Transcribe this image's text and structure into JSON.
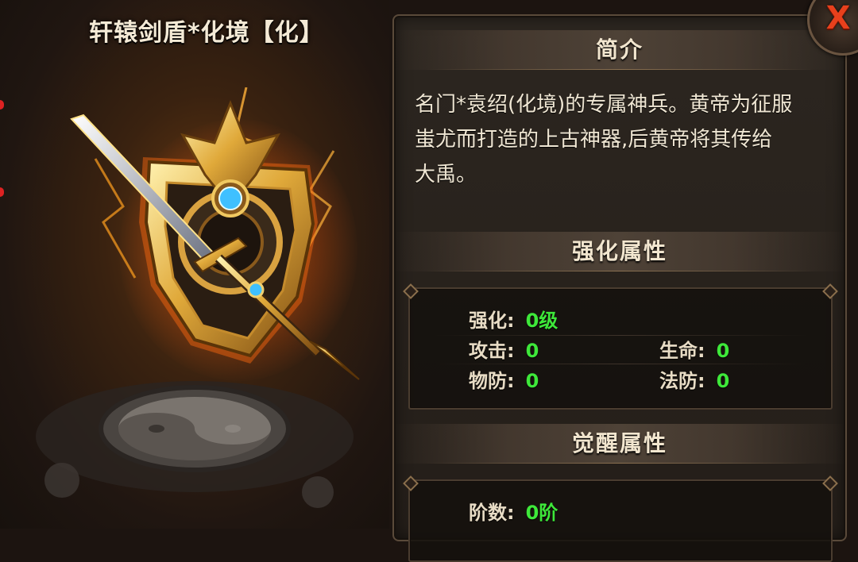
{
  "item": {
    "title": "轩辕剑盾*化境【化】",
    "glow_color": "#ff8c1a",
    "gem_color": "#3fc0ff"
  },
  "intro": {
    "header": "简介",
    "lines": [
      "名门*袁绍(化境)的专属神兵。黄帝为征服",
      "蚩尤而打造的上古神器,后黄帝将其传给",
      "大禹。"
    ]
  },
  "enhance": {
    "header": "强化属性",
    "level": {
      "label": "强化:",
      "value": "0级"
    },
    "attack": {
      "label": "攻击:",
      "value": "0"
    },
    "hp": {
      "label": "生命:",
      "value": "0"
    },
    "phys_def": {
      "label": "物防:",
      "value": "0"
    },
    "magic_def": {
      "label": "法防:",
      "value": "0"
    }
  },
  "awaken": {
    "header": "觉醒属性",
    "rank": {
      "label": "阶数:",
      "value": "0阶"
    }
  },
  "close": {
    "label": "X",
    "icon": "close-icon",
    "color": "#e8401c"
  },
  "colors": {
    "stat_value": "#3ee83a",
    "stat_label": "#e8dcc5",
    "panel_bg": "#2a241e"
  }
}
